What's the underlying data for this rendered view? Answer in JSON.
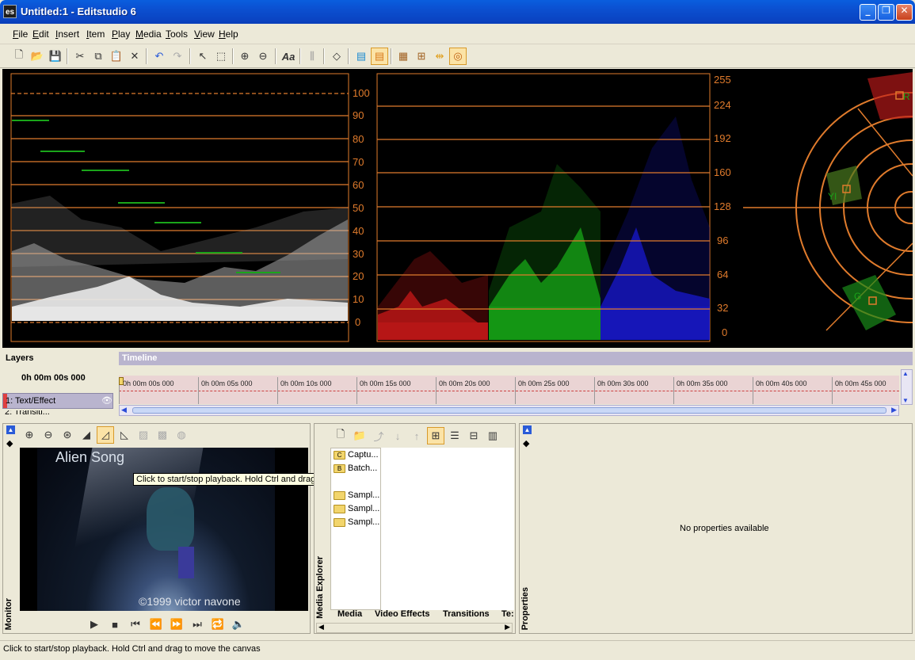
{
  "window": {
    "title": "Untitled:1 - Editstudio 6",
    "app_icon": "es",
    "min_icon": "minimize-icon",
    "max_icon": "restore-icon",
    "close_icon": "close-icon"
  },
  "menu": [
    "File",
    "Edit",
    "Insert",
    "Item",
    "Play",
    "Media",
    "Tools",
    "View",
    "Help"
  ],
  "scopes": {
    "waveform_ticks": [
      "100",
      "90",
      "80",
      "70",
      "60",
      "50",
      "40",
      "30",
      "20",
      "10",
      "0"
    ],
    "parade_ticks": [
      "255",
      "224",
      "192",
      "160",
      "128",
      "96",
      "64",
      "32",
      "0"
    ],
    "vectorscope_labels": [
      "R",
      "YI",
      "G"
    ],
    "accent_color": "#e07b2c"
  },
  "layers": {
    "header": "Layers",
    "time": "0h 00m 00s 000",
    "items": [
      "1: Text/Effect",
      "2: Transiti..."
    ]
  },
  "timeline": {
    "header": "Timeline",
    "ticks": [
      "0h 00m 00s 000",
      "0h 00m 05s 000",
      "0h 00m 10s 000",
      "0h 00m 15s 000",
      "0h 00m 20s 000",
      "0h 00m 25s 000",
      "0h 00m 30s 000",
      "0h 00m 35s 000",
      "0h 00m 40s 000",
      "0h 00m 45s 000"
    ]
  },
  "monitor": {
    "label": "Monitor",
    "video_title": "Alien Song",
    "video_credit": "©1999 victor navone",
    "tooltip": "Click to start/stop playback. Hold Ctrl and drag to move the canvas"
  },
  "media_explorer": {
    "label": "Media Explorer",
    "items": [
      {
        "icon": "capture-folder-icon",
        "letter": "C",
        "name": "Captu..."
      },
      {
        "icon": "batch-folder-icon",
        "letter": "B",
        "name": "Batch..."
      },
      {
        "icon": "folder-icon",
        "letter": "",
        "name": "Sampl..."
      },
      {
        "icon": "folder-icon",
        "letter": "",
        "name": "Sampl..."
      },
      {
        "icon": "folder-icon",
        "letter": "",
        "name": "Sampl..."
      }
    ],
    "tabs": [
      "Media",
      "Video Effects",
      "Transitions",
      "Te:"
    ]
  },
  "properties": {
    "label": "Properties",
    "empty_text": "No properties available"
  },
  "status": {
    "text": "Click to start/stop playback. Hold Ctrl and drag to move the canvas"
  }
}
